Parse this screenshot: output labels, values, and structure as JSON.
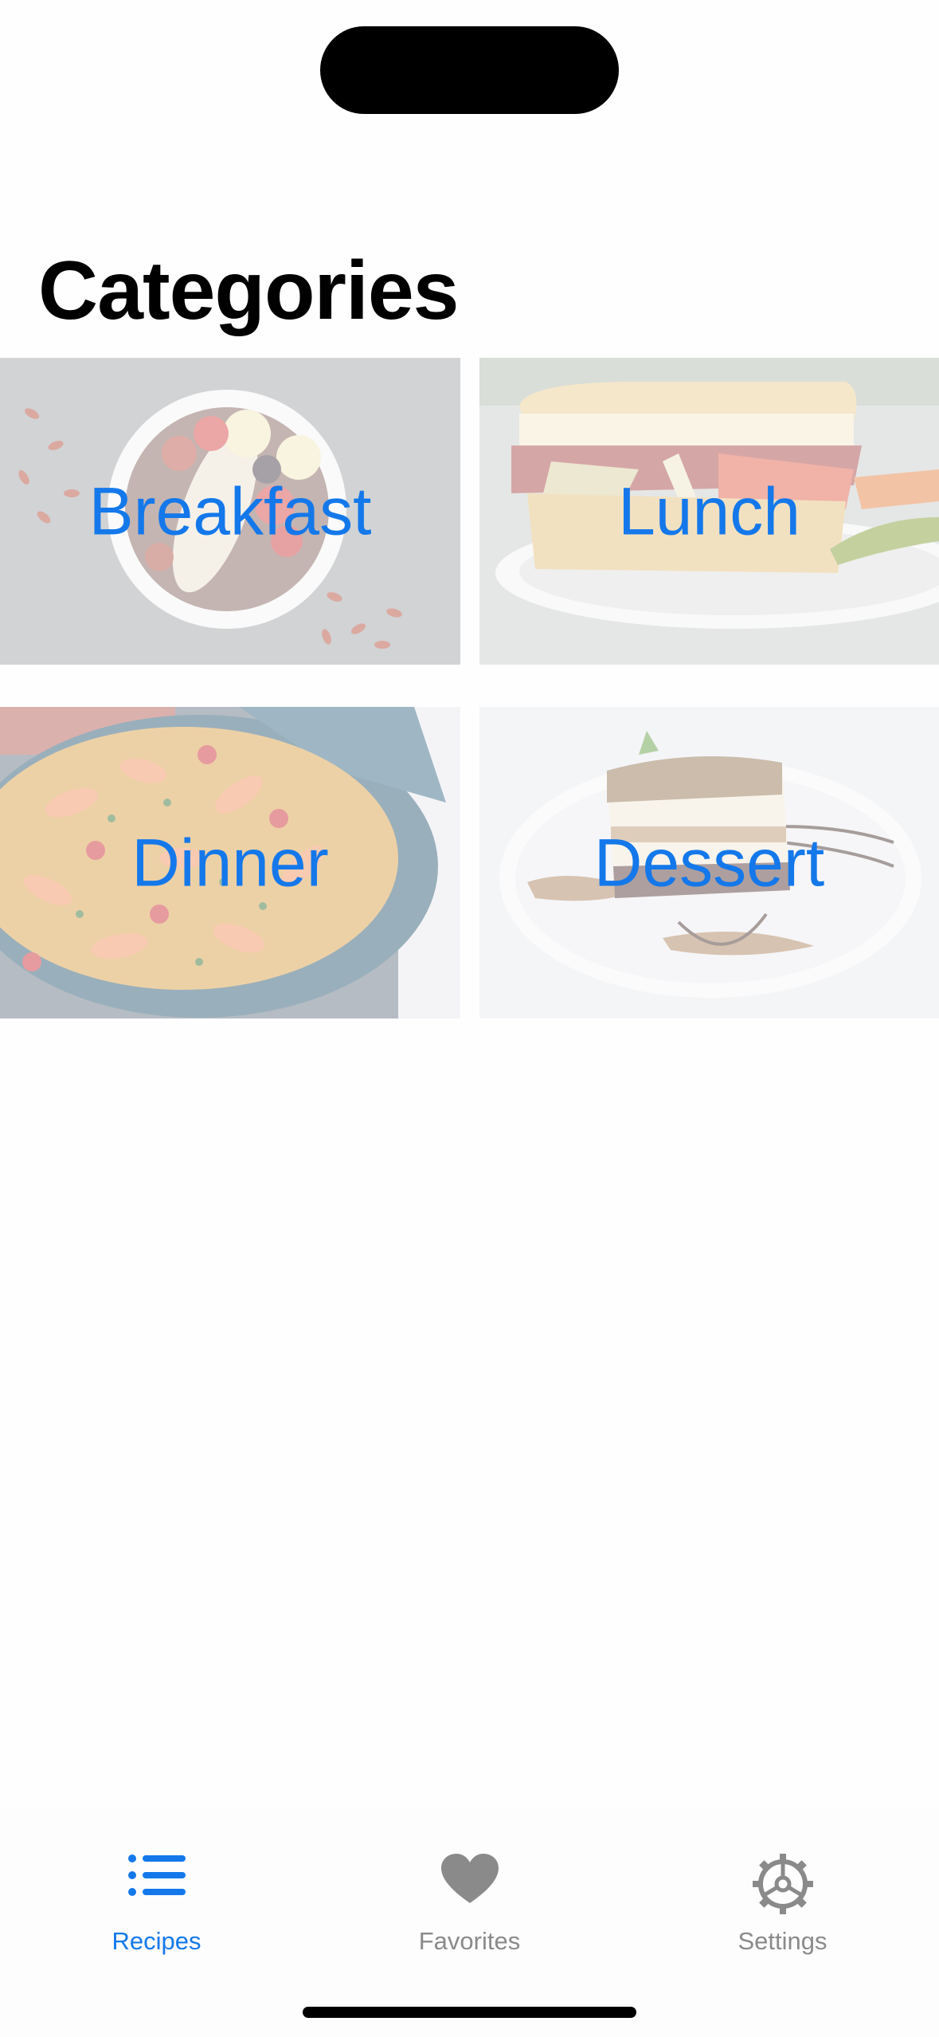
{
  "screen": {
    "title": "Categories"
  },
  "categories": [
    {
      "label": "Breakfast"
    },
    {
      "label": "Lunch"
    },
    {
      "label": "Dinner"
    },
    {
      "label": "Dessert"
    }
  ],
  "tabbar": {
    "items": [
      {
        "label": "Recipes",
        "icon": "list-icon",
        "selected": true
      },
      {
        "label": "Favorites",
        "icon": "heart-icon",
        "selected": false
      },
      {
        "label": "Settings",
        "icon": "gear-icon",
        "selected": false
      }
    ]
  },
  "colors": {
    "accent": "#1478ea",
    "tab_inactive": "#8a8a8a",
    "title": "#000000"
  }
}
